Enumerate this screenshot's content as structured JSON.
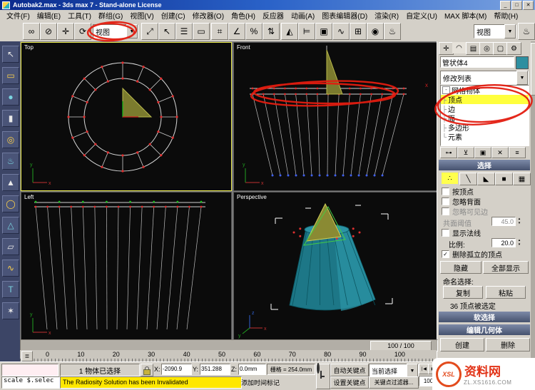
{
  "window": {
    "title": "Autobak2.max - 3ds max 7 - Stand-alone License",
    "minimize": "_",
    "maximize": "□",
    "close": "✕"
  },
  "menu": {
    "items": [
      "文件(F)",
      "编辑(E)",
      "工具(T)",
      "群组(G)",
      "视图(V)",
      "创建(C)",
      "修改器(O)",
      "角色(H)",
      "反应器",
      "动画(A)",
      "图表编辑器(D)",
      "渲染(R)",
      "自定义(U)",
      "MAX 脚本(M)",
      "帮助(H)"
    ]
  },
  "toolbar": {
    "ref_coord_value": "视图",
    "render_type_value": "视图"
  },
  "icons": {
    "link": "∞",
    "unlink": "⊘",
    "move": "✛",
    "rotate": "⟳",
    "scale": "⤢",
    "select": "↖",
    "by_name": "☰",
    "region": "▭",
    "snap3": "⌗",
    "angle_snap": "∠",
    "percent_snap": "%",
    "spinner_snap": "⇅",
    "mirror": "◭",
    "align": "⊨",
    "layers": "▣",
    "curve": "∿",
    "schematic": "⊞",
    "material": "◉",
    "teapot": "♨",
    "dropdown_arrow": "▼",
    "check": "✓",
    "minus": "-",
    "tree_branch": "├",
    "tree_end": "└",
    "spin_up": "▴",
    "spin_down": "▾",
    "trackbar": "≣",
    "tab_create": "✛",
    "tab_modify": "◠",
    "tab_hierarchy": "▤",
    "tab_motion": "◎",
    "tab_display": "▢",
    "tab_utils": "⚙",
    "so_vertex": "∴",
    "so_edge": "╲",
    "so_face": "◣",
    "so_poly": "■",
    "so_elem": "▦",
    "st_pin": "⊶",
    "st_show": "⊻",
    "st_unique": "▣",
    "st_remove": "✕",
    "st_config": "≡",
    "tr_start": "∣◀",
    "tr_prev": "◀",
    "tr_play": "▶",
    "tr_end": "▶∣"
  },
  "left_icons": [
    "↖",
    "▭",
    "●",
    "▮",
    "◎",
    "♨",
    "▲",
    "◯",
    "△",
    "▱",
    "∿",
    "T",
    "✶"
  ],
  "viewports": {
    "top": "Top",
    "front": "Front",
    "left": "Left",
    "perspective": "Perspective"
  },
  "axis": {
    "x": "x",
    "y": "y",
    "z": "z"
  },
  "command_panel": {
    "object_name": "管状体4",
    "modifier_list": "修改列表",
    "stack": {
      "root": "网格物体",
      "items": [
        "顶点",
        "边",
        "面",
        "多边形",
        "元素"
      ]
    },
    "selection": {
      "title": "选择",
      "by_vertex": "按顶点",
      "ignore_backfacing": "忽略背面",
      "ignore_visible_edges": "忽略可见边",
      "planar_thresh_label": "共面阈值",
      "planar_thresh_value": "45.0",
      "show_normals": "显示法线",
      "scale_label": "比例:",
      "scale_value": "20.0",
      "delete_isolated": "删除孤立的顶点",
      "hide": "隐藏",
      "unhide_all": "全部显示",
      "named_selections": "命名选择:",
      "copy": "复制",
      "paste": "粘贴",
      "status": "36 顶点被选定"
    },
    "soft_selection": "软选择",
    "edit_geometry": "编辑几何体",
    "create": "创建",
    "delete": "删除"
  },
  "timeline": {
    "frame_display": "100 / 100"
  },
  "ruler": {
    "ticks": [
      "0",
      "10",
      "20",
      "30",
      "40",
      "50",
      "60",
      "70",
      "80",
      "90",
      "100"
    ]
  },
  "status": {
    "listener_text": "scale $.selec",
    "selection": "1 物体已选择",
    "x_label": "X:",
    "x_value": "-2090.9",
    "y_label": "Y:",
    "y_value": "351.288",
    "z_label": "Z:",
    "z_value": "0.0mm",
    "grid": "栅格 = 254.0mm",
    "prompt": "The Radiosity Solution has been Invalidated",
    "add_time_tag": "添加时间标记",
    "auto_key": "自动关键点",
    "set_key": "设置关键点",
    "selection_set": "当前选择",
    "key_filters": "关键点过滤器...",
    "frame_field": "100"
  },
  "watermark": {
    "logo_text": "XSL",
    "site_name": "资料网",
    "site_url": "ZL.XS1616.COM"
  }
}
